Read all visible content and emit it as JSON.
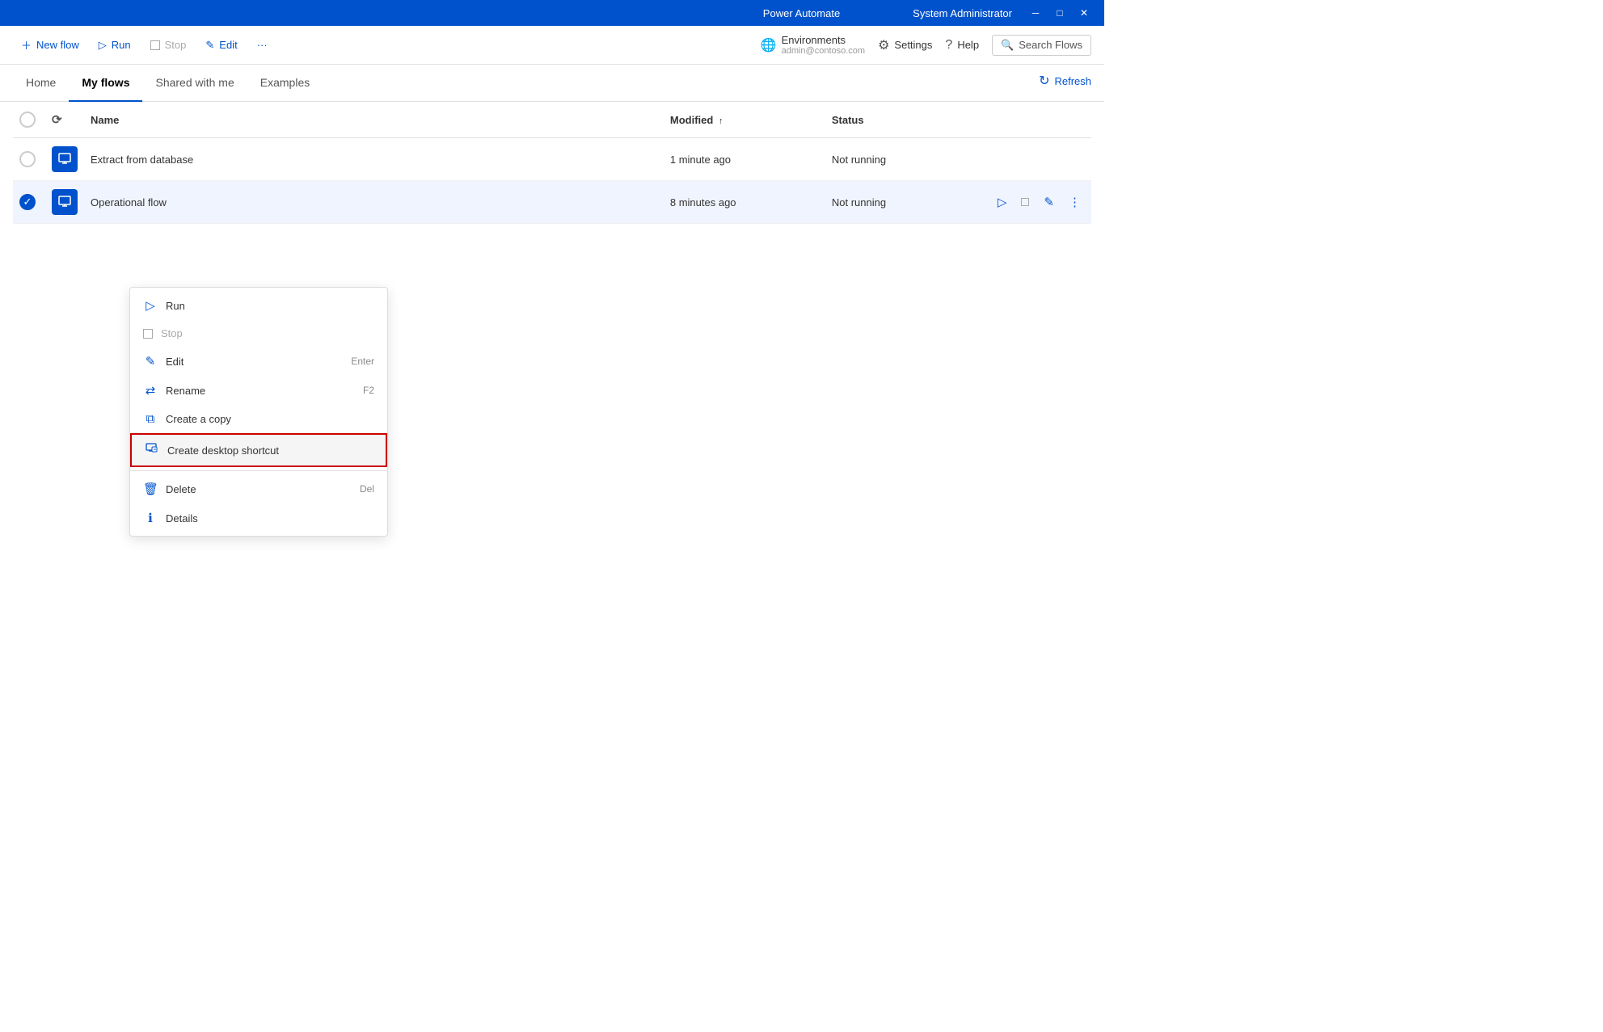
{
  "titleBar": {
    "title": "Power Automate",
    "user": "System Administrator",
    "minBtn": "─",
    "maxBtn": "□",
    "closeBtn": "✕"
  },
  "toolbar": {
    "newFlow": "New flow",
    "run": "Run",
    "stop": "Stop",
    "edit": "Edit",
    "more": "···",
    "environments": "Environments",
    "envName": "admin@contoso.com",
    "settings": "Settings",
    "help": "Help",
    "searchFlows": "Search Flows"
  },
  "nav": {
    "tabs": [
      "Home",
      "My flows",
      "Shared with me",
      "Examples"
    ],
    "activeTab": "My flows",
    "refresh": "Refresh"
  },
  "table": {
    "cols": {
      "name": "Name",
      "modified": "Modified",
      "status": "Status"
    },
    "rows": [
      {
        "id": 1,
        "name": "Extract from database",
        "modified": "1 minute ago",
        "status": "Not running",
        "selected": false
      },
      {
        "id": 2,
        "name": "Operational flow",
        "modified": "8 minutes ago",
        "status": "Not running",
        "selected": true
      }
    ]
  },
  "contextMenu": {
    "items": [
      {
        "id": "run",
        "label": "Run",
        "icon": "▷",
        "shortcut": "",
        "disabled": false,
        "highlighted": false
      },
      {
        "id": "stop",
        "label": "Stop",
        "icon": "□",
        "shortcut": "",
        "disabled": true,
        "highlighted": false
      },
      {
        "id": "edit",
        "label": "Edit",
        "icon": "✎",
        "shortcut": "Enter",
        "disabled": false,
        "highlighted": false
      },
      {
        "id": "rename",
        "label": "Rename",
        "icon": "⇄",
        "shortcut": "F2",
        "disabled": false,
        "highlighted": false
      },
      {
        "id": "copy",
        "label": "Create a copy",
        "icon": "⧉",
        "shortcut": "",
        "disabled": false,
        "highlighted": false
      },
      {
        "id": "shortcut",
        "label": "Create desktop shortcut",
        "icon": "🖥",
        "shortcut": "",
        "disabled": false,
        "highlighted": true
      },
      {
        "id": "delete",
        "label": "Delete",
        "icon": "🗑",
        "shortcut": "Del",
        "disabled": false,
        "highlighted": false
      },
      {
        "id": "details",
        "label": "Details",
        "icon": "ℹ",
        "shortcut": "",
        "disabled": false,
        "highlighted": false
      }
    ]
  }
}
